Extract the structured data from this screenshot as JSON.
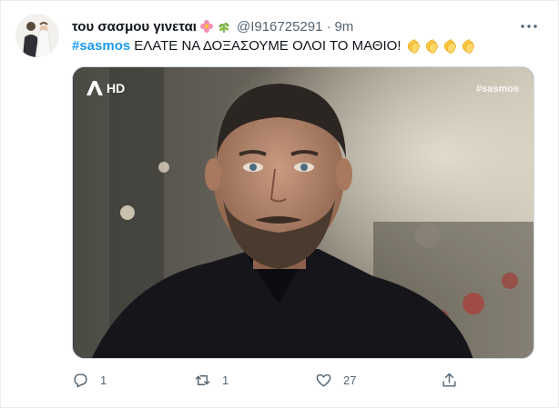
{
  "tweet": {
    "display_name": "του σασμου γινεται",
    "handle": "@I916725291",
    "separator": "·",
    "time": "9m",
    "hashtag": "#sasmos",
    "text": "ΕΛΑΤΕ ΝΑ ΔΟΞΑΣΟΥΜΕ ΟΛΟΙ ΤΟ ΜΑΘΙΟ!",
    "name_emojis": [
      "flower-icon",
      "herb-icon"
    ],
    "text_emojis": [
      "clapping-hands-icon",
      "clapping-hands-icon",
      "clapping-hands-icon",
      "clapping-hands-icon"
    ]
  },
  "media": {
    "channel_logo": "HD",
    "watermark": "#sasmos"
  },
  "actions": {
    "reply_count": "1",
    "retweet_count": "1",
    "like_count": "27"
  },
  "colors": {
    "accent": "#1d9bf0",
    "muted": "#536471",
    "text": "#0f1419",
    "border": "#cfd9de"
  }
}
